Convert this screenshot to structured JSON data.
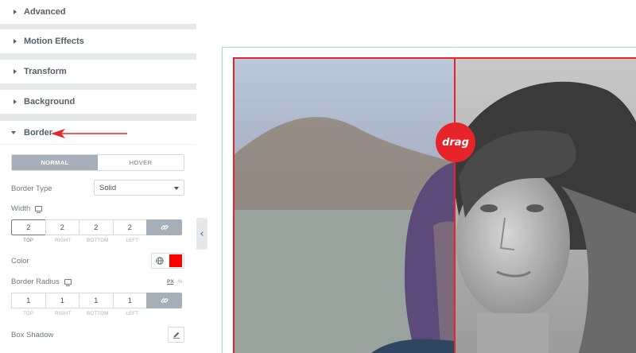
{
  "panel": {
    "sections": {
      "advanced": "Advanced",
      "motion_effects": "Motion Effects",
      "transform": "Transform",
      "background": "Background",
      "border": "Border"
    },
    "border": {
      "tabs": {
        "normal": "NORMAL",
        "hover": "HOVER"
      },
      "border_type_label": "Border Type",
      "border_type_value": "Solid",
      "width_label": "Width",
      "width_values": {
        "top": "2",
        "right": "2",
        "bottom": "2",
        "left": "2"
      },
      "dim_labels": {
        "top": "TOP",
        "right": "RIGHT",
        "bottom": "BOTTOM",
        "left": "LEFT"
      },
      "color_label": "Color",
      "color_value": "#ff0000",
      "radius_label": "Border Radius",
      "radius_units": {
        "px": "PX",
        "percent": "%"
      },
      "radius_values": {
        "top": "1",
        "right": "1",
        "bottom": "1",
        "left": "1"
      },
      "box_shadow_label": "Box Shadow"
    }
  },
  "canvas": {
    "drag_handle_label": "drag",
    "accent_color": "#e8242b"
  },
  "icons": {
    "section_caret": "caret-right-icon",
    "monitor": "desktop-icon",
    "link": "link-icon",
    "globe": "globe-icon",
    "edit": "pencil-icon",
    "collapse": "chevron-left-icon"
  }
}
